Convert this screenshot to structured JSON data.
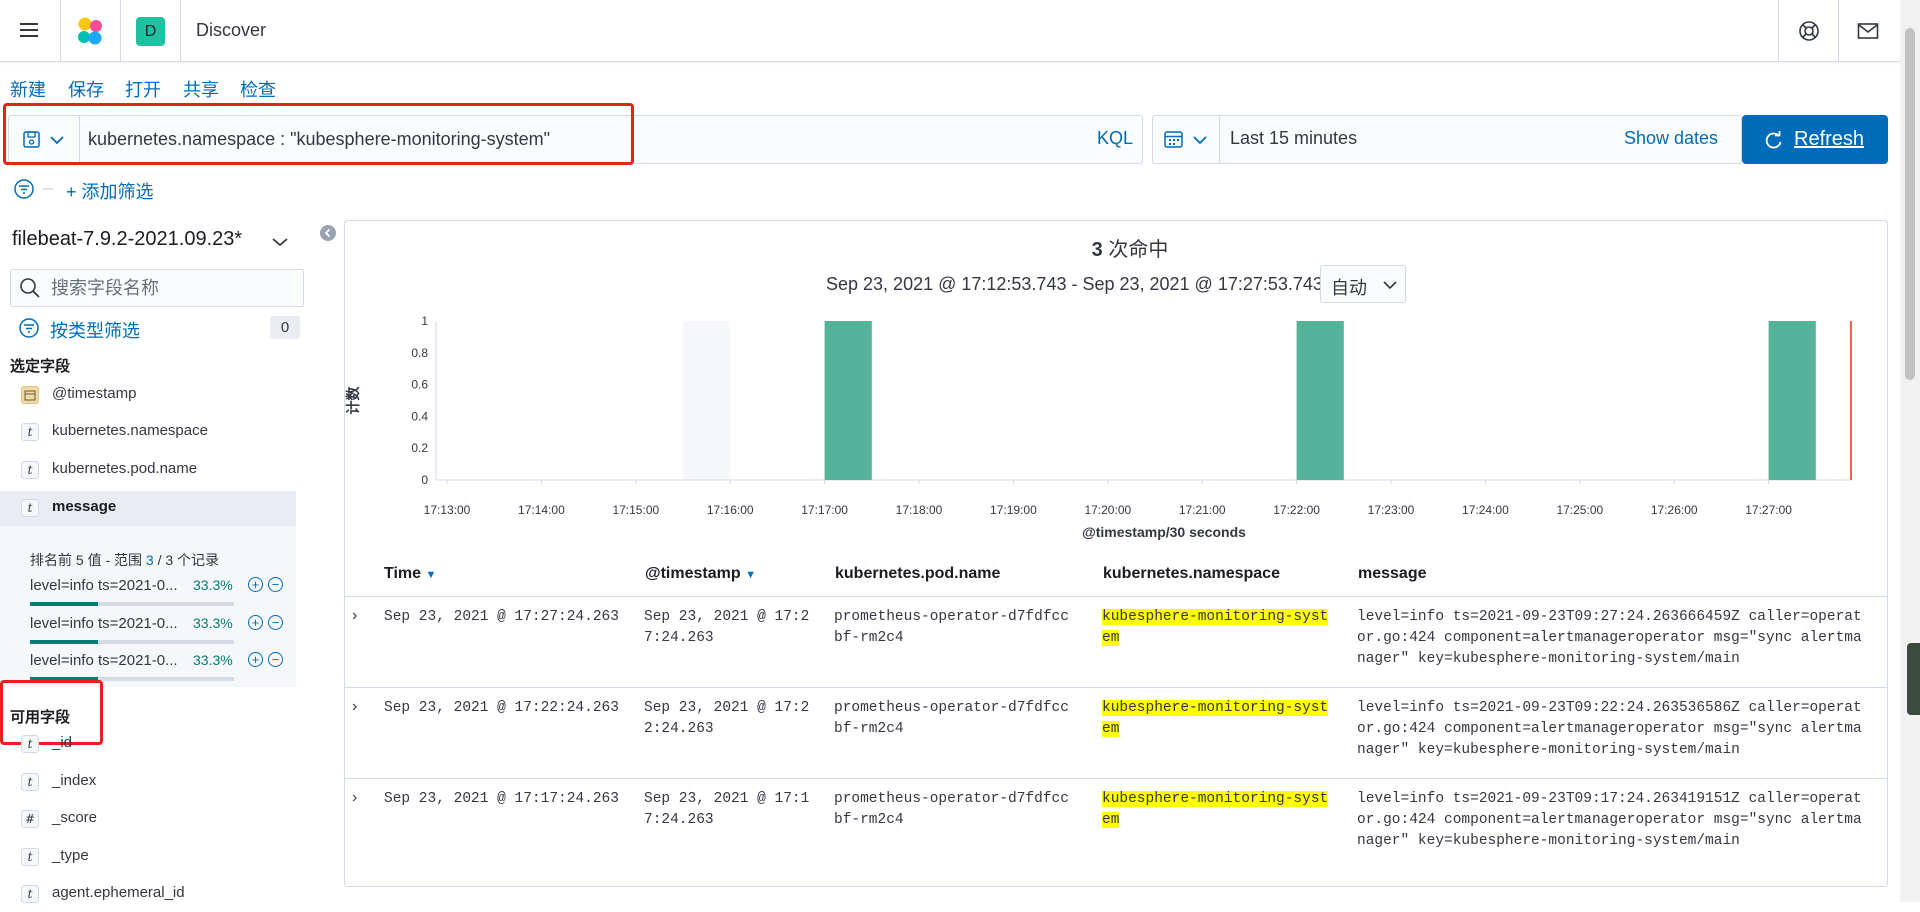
{
  "header": {
    "badge_letter": "D",
    "app_title": "Discover"
  },
  "menu": {
    "new": "新建",
    "save": "保存",
    "open": "打开",
    "share": "共享",
    "inspect": "检查"
  },
  "query": {
    "text": "kubernetes.namespace : \"kubesphere-monitoring-system\"",
    "language": "KQL"
  },
  "time": {
    "range_label": "Last 15 minutes",
    "show_dates": "Show dates",
    "refresh": "Refresh"
  },
  "filters": {
    "add_filter": "+ 添加筛选"
  },
  "sidebar": {
    "index_pattern": "filebeat-7.9.2-2021.09.23*",
    "search_placeholder": "搜索字段名称",
    "filter_by_type": "按类型筛选",
    "filter_count": "0",
    "selected_title": "选定字段",
    "selected_fields": [
      {
        "type": "date",
        "name": "@timestamp"
      },
      {
        "type": "t",
        "name": "kubernetes.namespace"
      },
      {
        "type": "t",
        "name": "kubernetes.pod.name"
      },
      {
        "type": "t",
        "name": "message"
      }
    ],
    "message_details": {
      "top5_prefix": "排名前 5 值 - 范围 ",
      "top5_count": "3",
      "top5_suffix": " / 3 个记录",
      "values": [
        {
          "text": "level=info ts=2021-0...",
          "pct": "33.3%",
          "fill": 0.333
        },
        {
          "text": "level=info ts=2021-0...",
          "pct": "33.3%",
          "fill": 0.333
        },
        {
          "text": "level=info ts=2021-0...",
          "pct": "33.3%",
          "fill": 0.333
        }
      ]
    },
    "available_title": "可用字段",
    "available_fields": [
      {
        "type": "t",
        "name": "_id"
      },
      {
        "type": "t",
        "name": "_index"
      },
      {
        "type": "#",
        "name": "_score"
      },
      {
        "type": "t",
        "name": "_type"
      },
      {
        "type": "t",
        "name": "agent.ephemeral_id"
      }
    ]
  },
  "results": {
    "hits_count": "3",
    "hits_label": " 次命中",
    "time_range": "Sep 23, 2021 @ 17:12:53.743 - Sep 23, 2021 @ 17:27:53.743",
    "interval": "自动"
  },
  "chart_data": {
    "type": "bar",
    "ylabel": "计数",
    "xlabel": "@timestamp/30 seconds",
    "y_ticks": [
      "1",
      "0.8",
      "0.6",
      "0.4",
      "0.2",
      "0"
    ],
    "x_ticks": [
      "17:13:00",
      "17:14:00",
      "17:15:00",
      "17:16:00",
      "17:17:00",
      "17:18:00",
      "17:19:00",
      "17:20:00",
      "17:21:00",
      "17:22:00",
      "17:23:00",
      "17:24:00",
      "17:25:00",
      "17:26:00",
      "17:27:00"
    ],
    "ylim": [
      0,
      1
    ],
    "bars": [
      {
        "x": "17:17:00",
        "value": 1
      },
      {
        "x": "17:22:00",
        "value": 1
      },
      {
        "x": "17:27:00",
        "value": 1
      }
    ],
    "bar_color": "#54b399"
  },
  "table": {
    "columns": [
      "Time",
      "@timestamp",
      "kubernetes.pod.name",
      "kubernetes.namespace",
      "message"
    ],
    "rows": [
      {
        "time": "Sep 23, 2021 @ 17:27:24.263",
        "ts_1": "Sep 23, 2021 @ 17:2",
        "ts_2": "7:24.263",
        "pod_1": "prometheus-operator-d7fdfcc",
        "pod_2": "bf-rm2c4",
        "ns_1": "kubesphere-monitoring-syst",
        "ns_2": "em",
        "msg_1": "level=info ts=2021-09-23T09:27:24.263666459Z caller=operat",
        "msg_2": "or.go:424 component=alertmanageroperator msg=\"sync alertma",
        "msg_3": "nager\" key=kubesphere-monitoring-system/main"
      },
      {
        "time": "Sep 23, 2021 @ 17:22:24.263",
        "ts_1": "Sep 23, 2021 @ 17:2",
        "ts_2": "2:24.263",
        "pod_1": "prometheus-operator-d7fdfcc",
        "pod_2": "bf-rm2c4",
        "ns_1": "kubesphere-monitoring-syst",
        "ns_2": "em",
        "msg_1": "level=info ts=2021-09-23T09:22:24.263536586Z caller=operat",
        "msg_2": "or.go:424 component=alertmanageroperator msg=\"sync alertma",
        "msg_3": "nager\" key=kubesphere-monitoring-system/main"
      },
      {
        "time": "Sep 23, 2021 @ 17:17:24.263",
        "ts_1": "Sep 23, 2021 @ 17:1",
        "ts_2": "7:24.263",
        "pod_1": "prometheus-operator-d7fdfcc",
        "pod_2": "bf-rm2c4",
        "ns_1": "kubesphere-monitoring-syst",
        "ns_2": "em",
        "msg_1": "level=info ts=2021-09-23T09:17:24.263419151Z caller=operat",
        "msg_2": "or.go:424 component=alertmanageroperator msg=\"sync alertma",
        "msg_3": "nager\" key=kubesphere-monitoring-system/main"
      }
    ]
  }
}
